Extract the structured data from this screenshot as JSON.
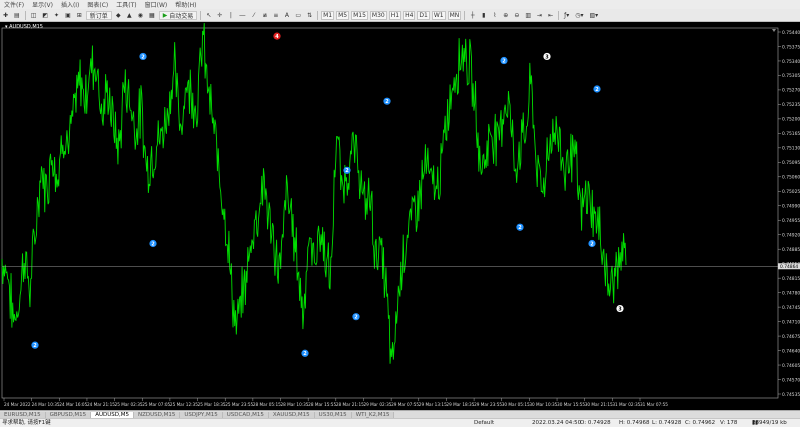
{
  "menu": [
    "文件(F)",
    "显示(V)",
    "插入(I)",
    "图表(C)",
    "工具(T)",
    "窗口(W)",
    "帮助(H)"
  ],
  "toolbar": {
    "new_order_label": "新订单",
    "auto_trade_label": "自动交易",
    "timeframes": [
      "M1",
      "M5",
      "M15",
      "M30",
      "H1",
      "H4",
      "D1",
      "W1",
      "MN"
    ]
  },
  "chart": {
    "symbol_label": "AUDUSD,M15",
    "current_price_label": "0.74864",
    "background": "#000000",
    "price_color": "#00dd00",
    "marker_blue": "#1e90ff",
    "marker_white": "#ffffff",
    "marker_red": "#e02020"
  },
  "chart_data": {
    "type": "line",
    "y_ticks": [
      "0.75440",
      "0.75375",
      "0.75340",
      "0.75305",
      "0.75270",
      "0.75235",
      "0.75200",
      "0.75165",
      "0.75130",
      "0.75095",
      "0.75060",
      "0.75025",
      "0.74990",
      "0.74955",
      "0.74920",
      "0.74885",
      "0.74850",
      "0.74815",
      "0.74780",
      "0.74745",
      "0.74710",
      "0.74675",
      "0.74640",
      "0.74605",
      "0.74570",
      "0.74535"
    ],
    "x_ticks": [
      "24 Mar 2022",
      "24 Mar 10:35",
      "24 Mar 16:05",
      "24 Mar 21:15",
      "25 Mar 02:35",
      "25 Mar 07:05",
      "25 Mar 12:35",
      "25 Mar 18:35",
      "25 Mar 23:55",
      "28 Mar 05:15",
      "28 Mar 10:35",
      "28 Mar 15:55",
      "28 Mar 21:15",
      "29 Mar 02:35",
      "29 Mar 07:55",
      "29 Mar 13:15",
      "29 Mar 18:35",
      "29 Mar 23:55",
      "30 Mar 05:15",
      "30 Mar 10:35",
      "30 Mar 15:55",
      "30 Mar 21:15",
      "31 Mar 02:35",
      "31 Mar 07:55"
    ],
    "ylim": [
      0.7454,
      0.7545
    ],
    "current_price": 0.74864,
    "series": [
      {
        "values": [
          0.7488,
          0.7485,
          0.7473,
          0.7477,
          0.749,
          0.748,
          0.7495,
          0.751,
          0.7505,
          0.7515,
          0.7508,
          0.752,
          0.7516,
          0.7525,
          0.7532,
          0.7528,
          0.7536,
          0.7536,
          0.7523,
          0.753,
          0.7521,
          0.7515,
          0.7532,
          0.7527,
          0.752,
          0.7525,
          0.751,
          0.7514,
          0.7517,
          0.752,
          0.7527,
          0.7535,
          0.752,
          0.7531,
          0.753,
          0.7525,
          0.7543,
          0.753,
          0.752,
          0.751,
          0.75,
          0.7485,
          0.747,
          0.7478,
          0.7485,
          0.7495,
          0.75,
          0.7508,
          0.7497,
          0.749,
          0.7485,
          0.7505,
          0.7498,
          0.7488,
          0.7475,
          0.7492,
          0.7488,
          0.7495,
          0.749,
          0.7482,
          0.752,
          0.7505,
          0.751,
          0.7515,
          0.7512,
          0.75,
          0.7505,
          0.749,
          0.749,
          0.748,
          0.746,
          0.7478,
          0.749,
          0.7495,
          0.75,
          0.7504,
          0.7512,
          0.7507,
          0.7505,
          0.7512,
          0.7524,
          0.7532,
          0.7537,
          0.754,
          0.7535,
          0.7525,
          0.751,
          0.7515,
          0.752,
          0.7517,
          0.7525,
          0.7528,
          0.751,
          0.7516,
          0.752,
          0.7532,
          0.751,
          0.7505,
          0.7515,
          0.752,
          0.7518,
          0.751,
          0.7515,
          0.7512,
          0.7498,
          0.7505,
          0.75,
          0.7496,
          0.749,
          0.748,
          0.7485,
          0.7488,
          0.7489
        ]
      }
    ],
    "markers": [
      {
        "label": "2",
        "x": 35,
        "y": 0.7467,
        "color": "blue"
      },
      {
        "label": "2",
        "x": 143,
        "y": 0.7538,
        "color": "blue"
      },
      {
        "label": "2",
        "x": 153,
        "y": 0.7492,
        "color": "blue"
      },
      {
        "label": "4",
        "x": 277,
        "y": 0.7543,
        "color": "red"
      },
      {
        "label": "2",
        "x": 305,
        "y": 0.7465,
        "color": "blue"
      },
      {
        "label": "2",
        "x": 347,
        "y": 0.751,
        "color": "blue"
      },
      {
        "label": "2",
        "x": 356,
        "y": 0.7474,
        "color": "blue"
      },
      {
        "label": "2",
        "x": 387,
        "y": 0.7527,
        "color": "blue"
      },
      {
        "label": "2",
        "x": 504,
        "y": 0.7537,
        "color": "blue"
      },
      {
        "label": "2",
        "x": 520,
        "y": 0.7496,
        "color": "blue"
      },
      {
        "label": "3",
        "x": 547,
        "y": 0.7538,
        "color": "white"
      },
      {
        "label": "2",
        "x": 592,
        "y": 0.7492,
        "color": "blue"
      },
      {
        "label": "2",
        "x": 597,
        "y": 0.753,
        "color": "blue"
      },
      {
        "label": "3",
        "x": 620,
        "y": 0.7476,
        "color": "white"
      }
    ]
  },
  "tabs": [
    {
      "label": "EURUSD,M15",
      "active": false
    },
    {
      "label": "GBPUSD,M15",
      "active": false
    },
    {
      "label": "AUDUSD,M5",
      "active": true
    },
    {
      "label": "NZDUSD,M15",
      "active": false
    },
    {
      "label": "USDJPY,M15",
      "active": false
    },
    {
      "label": "USDCAD,M15",
      "active": false
    },
    {
      "label": "XAUUSD,M15",
      "active": false
    },
    {
      "label": "US30,M15",
      "active": false
    },
    {
      "label": "WTI_K2,M15",
      "active": false
    }
  ],
  "status": {
    "help": "寻求帮助, 请按F1键",
    "profile": "Default",
    "time": "2022.03.24 04:50",
    "open": "O: 0.74928",
    "high": "H: 0.74968",
    "low": "L: 0.74928",
    "close": "C: 0.74962",
    "volume": "V: 178",
    "traffic": "28949/19 kb"
  }
}
